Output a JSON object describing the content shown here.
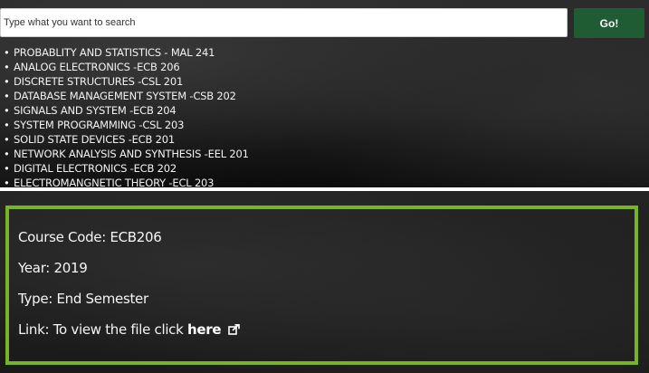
{
  "search": {
    "placeholder": "Type what you want to search",
    "value": "",
    "button_label": "Go!"
  },
  "courses": [
    "PROBABLITY AND STATISTICS - MAL 241",
    "ANALOG ELECTRONICS -ECB 206",
    "DISCRETE STRUCTURES -CSL 201",
    "DATABASE MANAGEMENT SYSTEM -CSB 202",
    "SIGNALS AND SYSTEM -ECB 204",
    "SYSTEM PROGRAMMING -CSL 203",
    "SOLID STATE DEVICES -ECB 201",
    "NETWORK ANALYSIS AND SYNTHESIS -EEL 201",
    "DIGITAL ELECTRONICS -ECB 202",
    "ELECTROMANGNETIC THEORY -ECL 203"
  ],
  "detail": {
    "course_code": "Course Code: ECB206",
    "year": "Year: 2019",
    "type": "Type: End Semester",
    "link_prefix": "Link: To view the file click",
    "link_label": "here",
    "link_icon": "external-link-icon"
  },
  "colors": {
    "go_button": "#1f5c33",
    "card_border": "#78b526",
    "chalkboard": "#1b1b1b",
    "chalk_text": "#f2f2f2"
  }
}
